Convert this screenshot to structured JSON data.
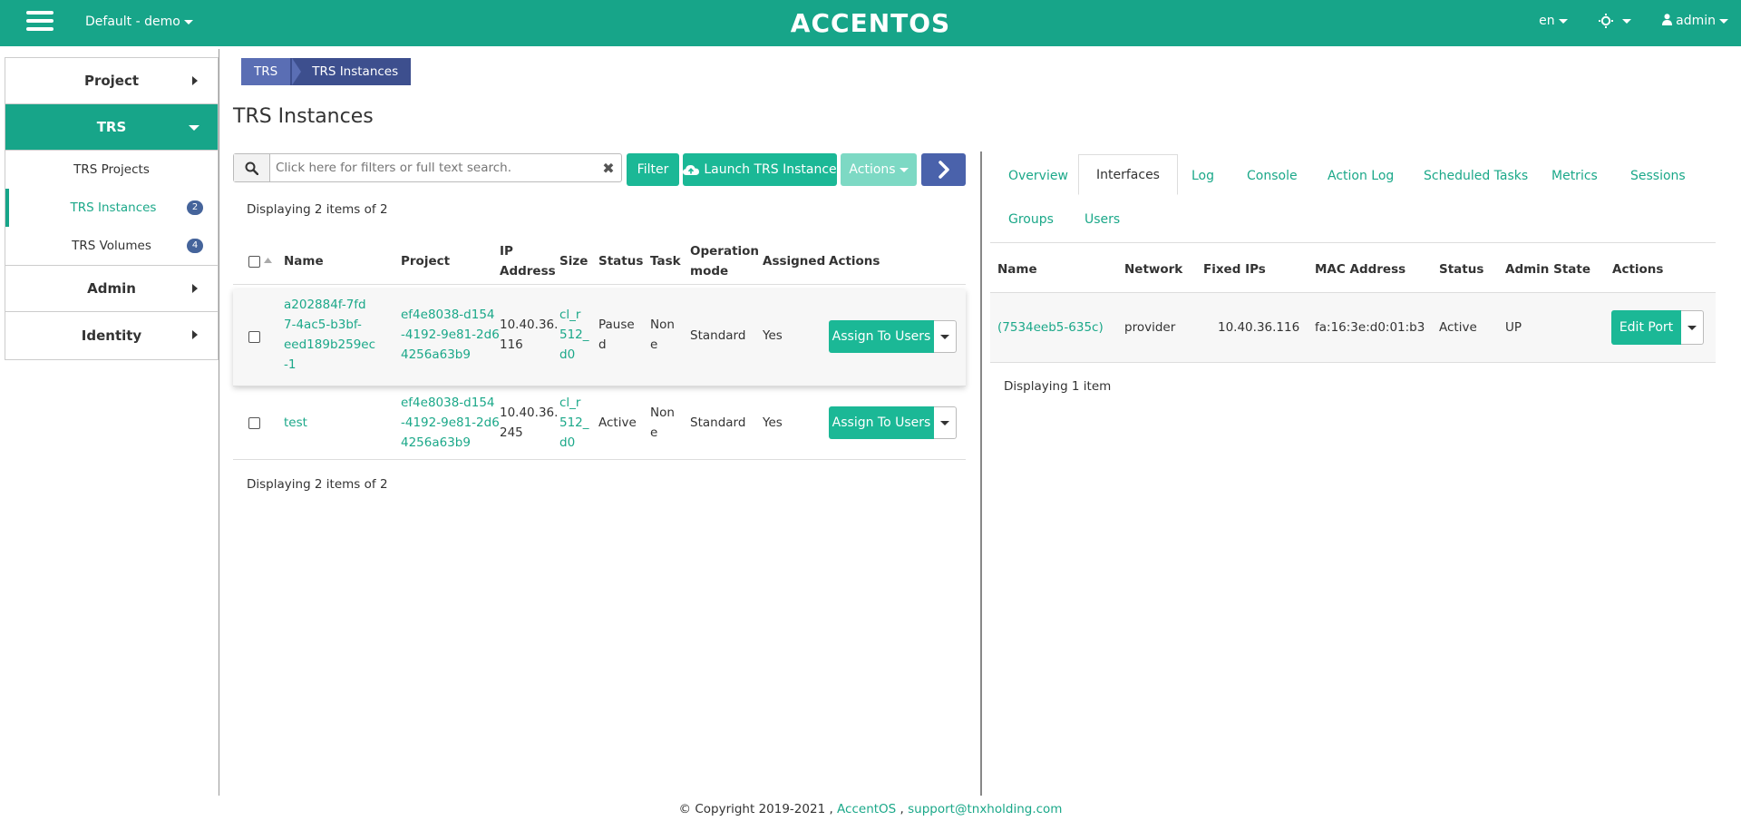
{
  "header": {
    "project_label": "Default - demo",
    "logo": "ACCENTOS",
    "language": "en",
    "user": "admin",
    "accent_color": "#17a589"
  },
  "sidebar": {
    "sections": [
      {
        "label": "Project"
      },
      {
        "label": "TRS"
      },
      {
        "label": "Admin"
      },
      {
        "label": "Identity"
      }
    ],
    "trs_items": [
      {
        "label": "TRS Projects"
      },
      {
        "label": "TRS Instances",
        "badge": "2"
      },
      {
        "label": "TRS Volumes",
        "badge": "4"
      }
    ]
  },
  "breadcrumb": [
    "TRS",
    "TRS Instances"
  ],
  "page_title": "TRS Instances",
  "toolbar": {
    "search_placeholder": "Click here for filters or full text search.",
    "filter_label": "Filter",
    "launch_label": "Launch TRS Instance",
    "actions_label": "Actions"
  },
  "instances": {
    "display_count": "Displaying 2 items of 2",
    "headers": {
      "name": "Name",
      "project": "Project",
      "ip1": "IP",
      "ip2": "Address",
      "size": "Size",
      "status": "Status",
      "task": "Task",
      "opmode1": "Operation",
      "opmode2": "mode",
      "assigned": "Assigned",
      "actions": "Actions"
    },
    "rows": [
      {
        "name_lines": [
          "a202884f-7fd",
          "7-4ac5-b3bf-",
          "eed189b259ec",
          "-1"
        ],
        "project_lines": [
          "ef4e8038-d154",
          "-4192-9e81-2d6",
          "4256a63b9"
        ],
        "ip_lines": [
          "10.40.36.",
          "116"
        ],
        "size_lines": [
          "cl_r",
          "512_",
          "d0"
        ],
        "status_lines": [
          "Pause",
          "d"
        ],
        "task_lines": [
          "Non",
          "e"
        ],
        "opmode": "Standard",
        "assigned": "Yes",
        "action_label": "Assign To Users"
      },
      {
        "name_lines": [
          "test"
        ],
        "project_lines": [
          "ef4e8038-d154",
          "-4192-9e81-2d6",
          "4256a63b9"
        ],
        "ip_lines": [
          "10.40.36.",
          "245"
        ],
        "size_lines": [
          "cl_r",
          "512_",
          "d0"
        ],
        "status_lines": [
          "Active"
        ],
        "task_lines": [
          "Non",
          "e"
        ],
        "opmode": "Standard",
        "assigned": "Yes",
        "action_label": "Assign To Users"
      }
    ]
  },
  "detail": {
    "tabs": [
      {
        "label": "Overview"
      },
      {
        "label": "Interfaces"
      },
      {
        "label": "Log"
      },
      {
        "label": "Console"
      },
      {
        "label": "Action Log"
      },
      {
        "label": "Scheduled Tasks"
      },
      {
        "label": "Metrics"
      },
      {
        "label": "Sessions"
      },
      {
        "label": "Groups"
      },
      {
        "label": "Users"
      }
    ],
    "active_tab": "Interfaces",
    "interfaces": {
      "headers": {
        "name": "Name",
        "network": "Network",
        "fixed_ips": "Fixed IPs",
        "mac": "MAC Address",
        "status": "Status",
        "admin_state": "Admin State",
        "actions": "Actions"
      },
      "rows": [
        {
          "name": "(7534eeb5-635c)",
          "network": "provider",
          "fixed_ips": "10.40.36.116",
          "mac": "fa:16:3e:d0:01:b3",
          "status": "Active",
          "admin_state": "UP",
          "action_label": "Edit Port"
        }
      ],
      "display_count": "Displaying 1 item"
    }
  },
  "footer": {
    "copyright": "© Copyright 2019-2021 ,",
    "brand_link": "AccentOS",
    "sep": ",",
    "email": "support@tnxholding.com"
  }
}
